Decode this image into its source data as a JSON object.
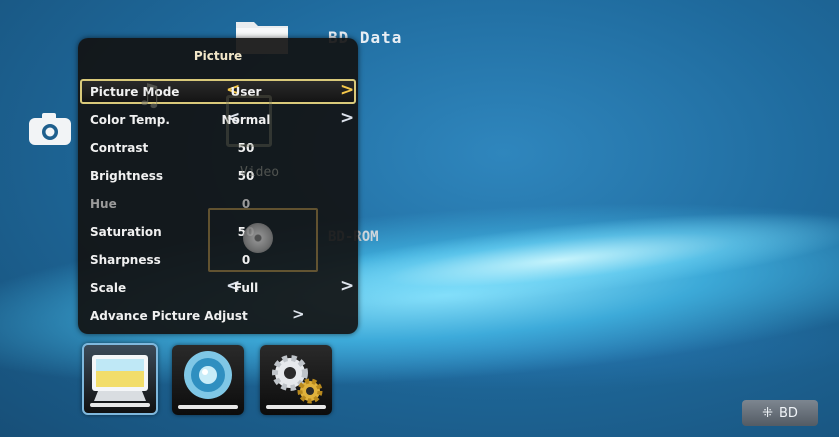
{
  "background": {
    "folder_title": "BD Data",
    "device_label": "BD-ROM",
    "ghost_label": "Video"
  },
  "panel": {
    "title": "Picture",
    "rows": [
      {
        "label": "Picture Mode",
        "value": "User",
        "left": "<",
        "right": ">"
      },
      {
        "label": "Color Temp.",
        "value": "Normal",
        "left": "<",
        "right": ">"
      },
      {
        "label": "Contrast",
        "value": "50"
      },
      {
        "label": "Brightness",
        "value": "50"
      },
      {
        "label": "Hue",
        "value": "0"
      },
      {
        "label": "Saturation",
        "value": "50"
      },
      {
        "label": "Sharpness",
        "value": "0"
      },
      {
        "label": "Scale",
        "value": "Full",
        "left": "<",
        "right": ">"
      },
      {
        "label": "Advance Picture Adjust",
        "go": ">"
      }
    ]
  },
  "tabs": [
    {
      "name": "picture",
      "icon": "monitor-icon"
    },
    {
      "name": "audio",
      "icon": "speaker-icon"
    },
    {
      "name": "system",
      "icon": "gears-icon"
    }
  ],
  "badge": {
    "label": "BD",
    "icon": "dots-icon"
  },
  "colors": {
    "accent": "#f5c84a",
    "highlight_border": "#d9c97a",
    "selected_tab": "#7fb8dd"
  }
}
